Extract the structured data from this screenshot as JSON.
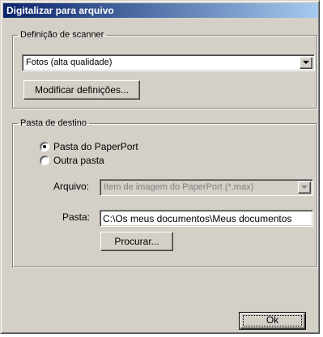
{
  "window": {
    "title": "Digitalizar para arquivo"
  },
  "scanner_group": {
    "legend": "Definição de scanner",
    "preset": {
      "selected": "Fotos (alta qualidade)",
      "arrow_icon": "chevron-down-icon"
    },
    "modify_button": "Modificar definições..."
  },
  "destination_group": {
    "legend": "Pasta de destino",
    "options": [
      {
        "label": "Pasta do PaperPort",
        "checked": true
      },
      {
        "label": "Outra pasta",
        "checked": false
      }
    ],
    "file_label": "Arquivo:",
    "file_value": "Item de imagem do PaperPort (*.max)",
    "folder_label": "Pasta:",
    "folder_value": "C:\\Os meus documentos\\Meus documentos",
    "browse_button": "Procurar..."
  },
  "ok_button": "Ok",
  "colors": {
    "title_start": "#0a246a",
    "title_end": "#a6caf0",
    "face": "#d4d0c8"
  }
}
